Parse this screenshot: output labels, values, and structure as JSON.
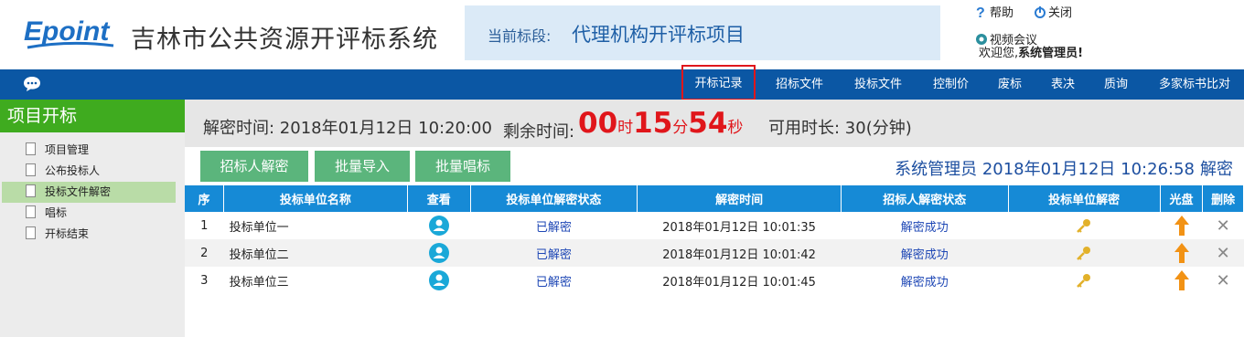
{
  "header": {
    "logo_text": "Epoint",
    "system_title": "吉林市公共资源开评标系统",
    "stage_label": "当前标段:",
    "stage_value": "代理机构开评标项目",
    "help_label": "帮助",
    "close_label": "关闭",
    "video_label": "视频会议",
    "welcome_prefix": "欢迎您,",
    "welcome_user": "系统管理员!"
  },
  "nav": {
    "items": [
      {
        "label": "开标记录",
        "active": true
      },
      {
        "label": "招标文件"
      },
      {
        "label": "投标文件"
      },
      {
        "label": "控制价"
      },
      {
        "label": "废标"
      },
      {
        "label": "表决"
      },
      {
        "label": "质询"
      },
      {
        "label": "多家标书比对"
      }
    ]
  },
  "sidebar": {
    "title": "项目开标",
    "items": [
      {
        "label": "项目管理"
      },
      {
        "label": "公布投标人"
      },
      {
        "label": "投标文件解密",
        "active": true
      },
      {
        "label": "唱标"
      },
      {
        "label": "开标结束"
      }
    ]
  },
  "info": {
    "decrypt_time": "解密时间: 2018年01月12日 10:20:00",
    "remaining_label": "剩余时间:",
    "cd_hours": "00",
    "cd_h_unit": "时",
    "cd_minutes": "15",
    "cd_m_unit": "分",
    "cd_seconds": "54",
    "cd_s_unit": "秒",
    "available": "可用时长: 30(分钟)"
  },
  "actions": {
    "btn1": "招标人解密",
    "btn2": "批量导入",
    "btn3": "批量唱标",
    "user_line": "系统管理员 2018年01月12日 10:26:58",
    "decrypt_link": "解密"
  },
  "table": {
    "headers": [
      "序",
      "投标单位名称",
      "查看",
      "投标单位解密状态",
      "解密时间",
      "招标人解密状态",
      "投标单位解密",
      "光盘",
      "删除"
    ],
    "rows": [
      {
        "no": "1",
        "name": "投标单位一",
        "status": "已解密",
        "time": "2018年01月12日 10:01:35",
        "owner_status": "解密成功"
      },
      {
        "no": "2",
        "name": "投标单位二",
        "status": "已解密",
        "time": "2018年01月12日 10:01:42",
        "owner_status": "解密成功"
      },
      {
        "no": "3",
        "name": "投标单位三",
        "status": "已解密",
        "time": "2018年01月12日 10:01:45",
        "owner_status": "解密成功"
      }
    ]
  },
  "colors": {
    "nav_bg": "#0b57a4",
    "sidebar_head": "#3fab1f",
    "table_head": "#168ad6",
    "button": "#5bb57c",
    "countdown": "#e0161b"
  }
}
